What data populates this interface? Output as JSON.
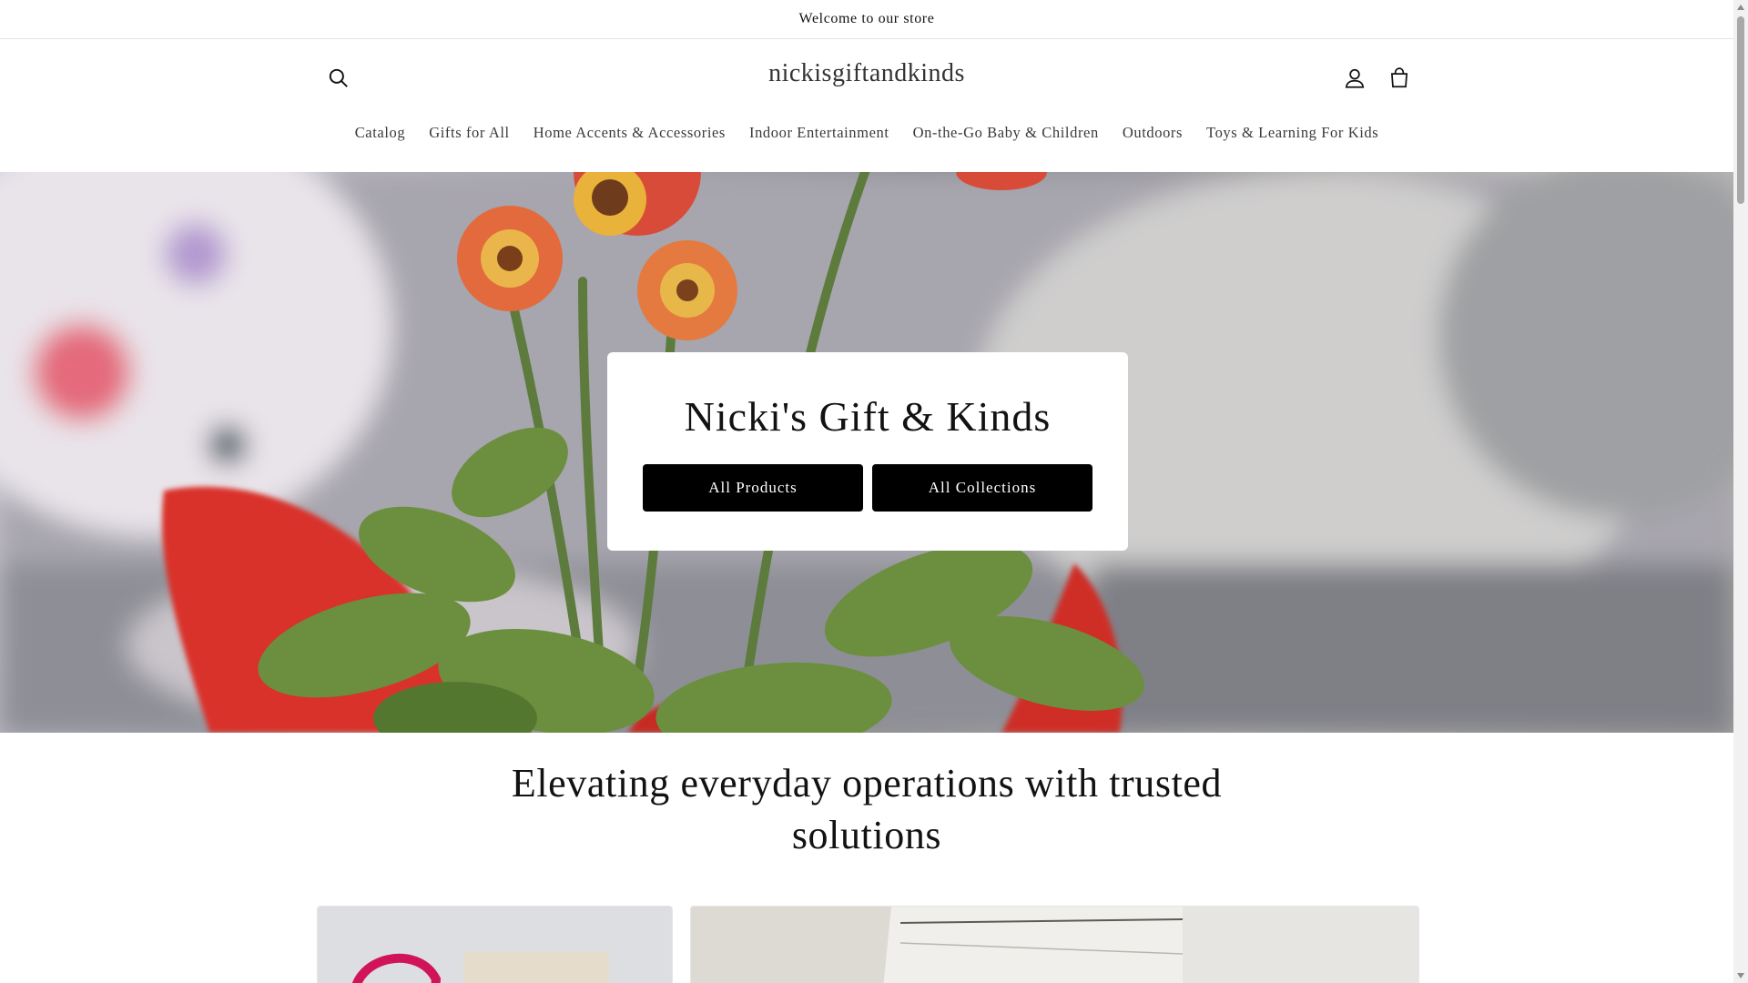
{
  "announcement": {
    "text": "Welcome to our store"
  },
  "header": {
    "brand": "nickisgiftandkinds",
    "icons": {
      "search": "search-icon",
      "account": "account-icon",
      "cart": "cart-icon"
    }
  },
  "nav": {
    "items": [
      {
        "label": "Catalog"
      },
      {
        "label": "Gifts for All"
      },
      {
        "label": "Home Accents & Accessories"
      },
      {
        "label": "Indoor Entertainment"
      },
      {
        "label": "On-the-Go Baby & Children"
      },
      {
        "label": "Outdoors"
      },
      {
        "label": "Toys & Learning For Kids"
      }
    ]
  },
  "hero": {
    "title": "Nicki's Gift & Kinds",
    "buttons": {
      "products": "All Products",
      "collections": "All Collections"
    }
  },
  "section": {
    "heading_line1": "Elevating everyday operations with trusted",
    "heading_line2": "solutions"
  },
  "colors": {
    "button_bg": "#000000",
    "button_text": "#ffffff",
    "ribbon": "#d9302a"
  }
}
